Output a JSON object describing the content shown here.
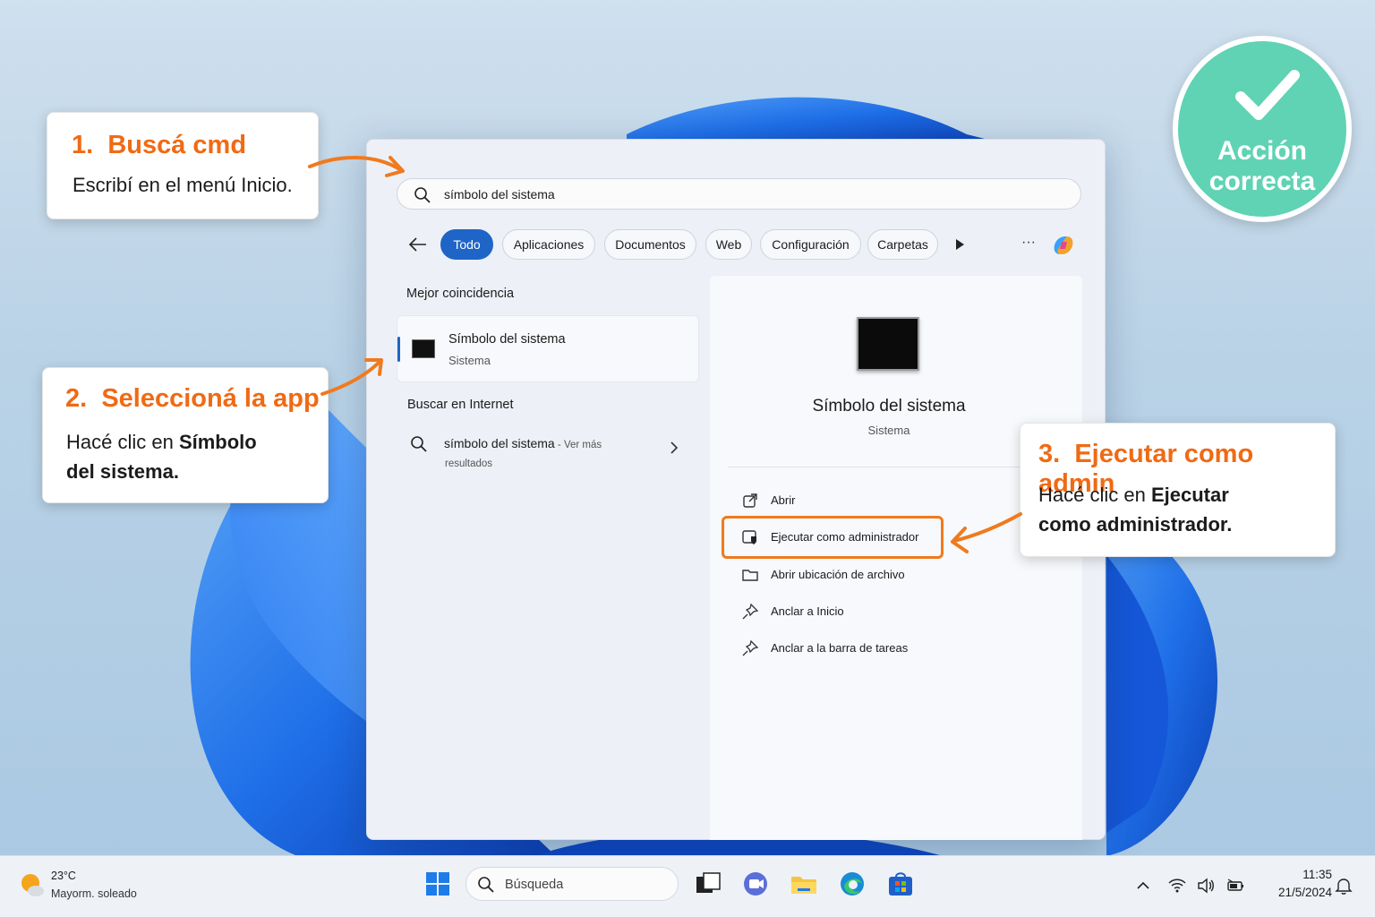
{
  "search_panel": {
    "query": "símbolo del sistema",
    "filters": [
      "Todo",
      "Aplicaciones",
      "Documentos",
      "Web",
      "Configuración",
      "Carpetas"
    ],
    "more_label": "···",
    "best_match_title": "Mejor coincidencia",
    "best_match": {
      "name": "Símbolo del sistema",
      "type": "Sistema"
    },
    "web_title": "Buscar en Internet",
    "web_result": {
      "query": "símbolo del sistema",
      "suffix": " - Ver más",
      "suffix2": "resultados"
    },
    "detail": {
      "name": "Símbolo del sistema",
      "type": "Sistema",
      "actions": [
        {
          "label": "Abrir",
          "icon": "open-external-icon"
        },
        {
          "label": "Ejecutar como administrador",
          "icon": "admin-shield-icon"
        },
        {
          "label": "Abrir ubicación de archivo",
          "icon": "folder-icon"
        },
        {
          "label": "Anclar a Inicio",
          "icon": "pin-icon"
        },
        {
          "label": "Anclar a la barra de tareas",
          "icon": "pin-icon"
        }
      ]
    }
  },
  "callouts": {
    "step1": {
      "num": "1.",
      "title": "Buscá cmd",
      "body": "Escribí en el menú Inicio."
    },
    "step2": {
      "num": "2.",
      "title": "Seleccioná la app",
      "body_plain": "Hacé clic en ",
      "body_bold1": "Símbolo",
      "body_bold2": "del sistema."
    },
    "step3": {
      "num": "3.",
      "title": "Ejecutar como admin",
      "body_plain": "Hacé clic en ",
      "body_bold1": "Ejecutar",
      "body_bold2": "como administrador."
    }
  },
  "badge": {
    "line1": "Acción",
    "line2": "correcta"
  },
  "taskbar": {
    "weather_temp": "23°C",
    "weather_desc": "Mayorm. soleado",
    "search_placeholder": "Búsqueda",
    "time": "11:35",
    "date": "21/5/2024"
  },
  "colors": {
    "accent": "#1f65c8",
    "callout_orange": "#f06a14",
    "badge_green": "#5fd3b3"
  }
}
